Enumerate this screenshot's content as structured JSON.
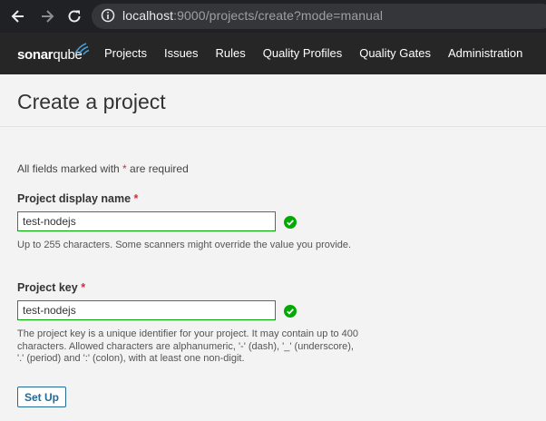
{
  "browser": {
    "url_host": "localhost",
    "url_rest": ":9000/projects/create?mode=manual",
    "icons": {
      "back": "back-arrow-icon",
      "forward": "forward-arrow-icon",
      "reload": "reload-icon",
      "site_info": "info-icon"
    }
  },
  "app": {
    "logo_bold": "sonar",
    "logo_light": "qube",
    "nav": [
      "Projects",
      "Issues",
      "Rules",
      "Quality Profiles",
      "Quality Gates",
      "Administration"
    ]
  },
  "page": {
    "title": "Create a project",
    "required_note_prefix": "All fields marked with ",
    "required_star": "*",
    "required_note_suffix": " are required"
  },
  "form": {
    "display_name": {
      "label": "Project display name",
      "star": "*",
      "value": "test-nodejs",
      "helper": "Up to 255 characters. Some scanners might override the value you provide."
    },
    "key": {
      "label": "Project key",
      "star": "*",
      "value": "test-nodejs",
      "helper": "The project key is a unique identifier for your project. It may contain up to 400 characters. Allowed characters are alphanumeric, '-' (dash), '_' (underscore), '.' (period) and ':' (colon), with at least one non-digit."
    },
    "submit_label": "Set Up"
  },
  "colors": {
    "nav_bg": "#262626",
    "valid": "#00aa00",
    "required": "#d02f3a",
    "button": "#236a97"
  }
}
